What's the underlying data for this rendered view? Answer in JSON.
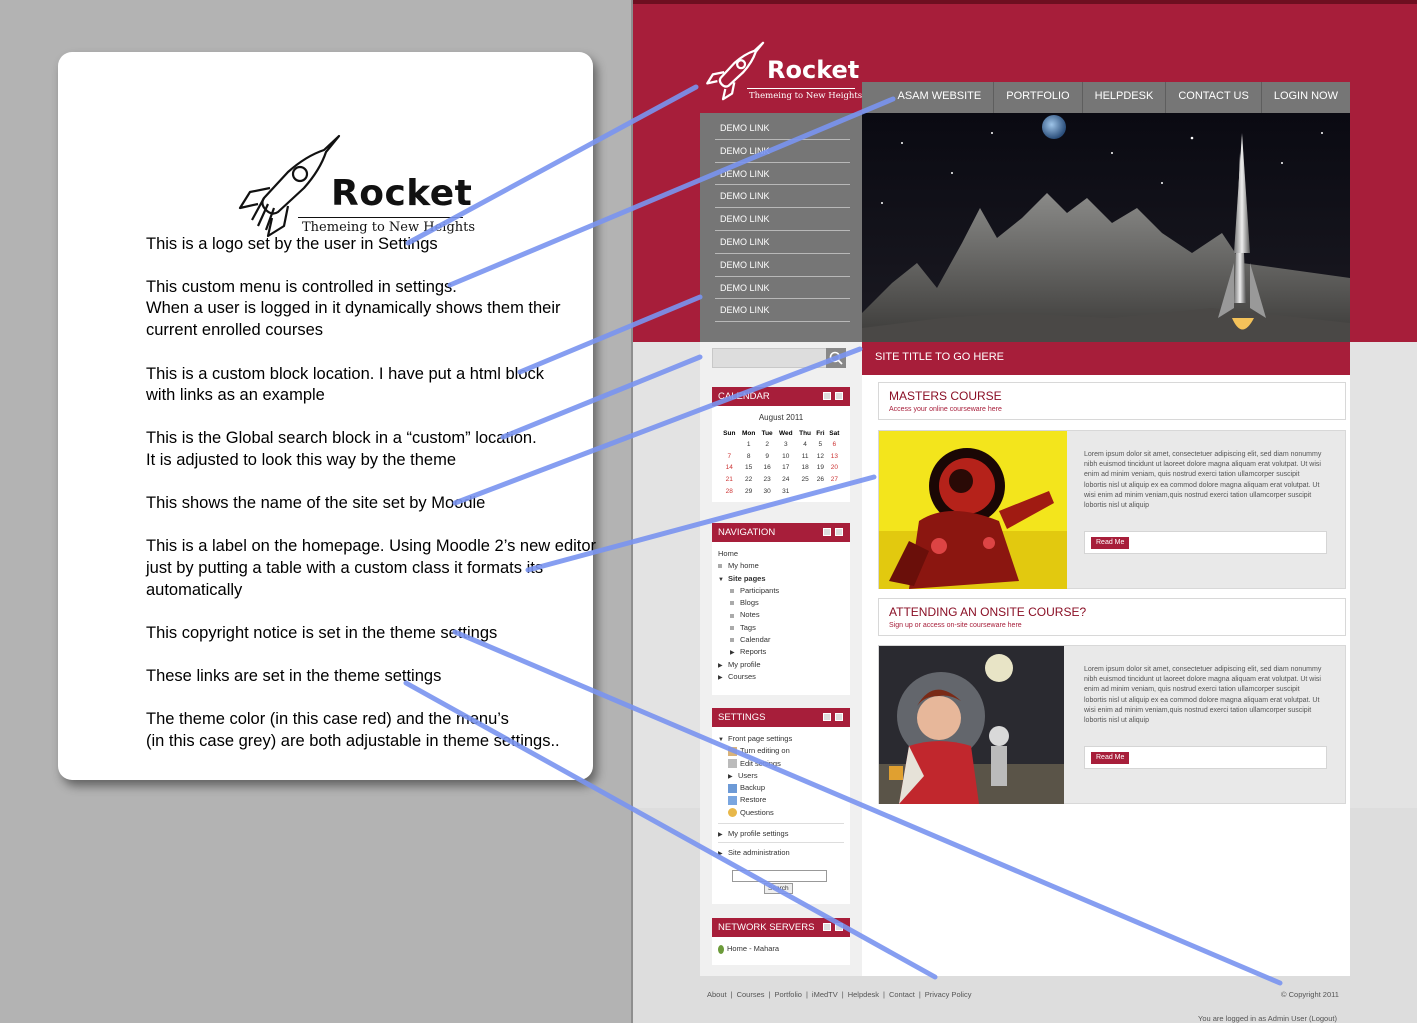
{
  "card": {
    "logo_name": "Rocket",
    "logo_tagline": "Themeing to New Heights",
    "notes": [
      "This is a logo set by the user in Settings",
      "This custom menu is controlled in settings.",
      "When a user is logged in it dynamically shows them their",
      "current enrolled courses",
      "This is a custom block location. I have put a html block",
      "with links as an example",
      "This is the Global search block in a “custom” location.",
      "It is adjusted to look this way by the theme",
      "This shows the name of the site set by Moodle",
      "This is a label on the homepage. Using Moodle 2’s new editor",
      "just by putting a table with a custom class it formats its",
      "automatically",
      "This copyright notice is set in the theme settings",
      "These links are set in the theme settings",
      "The theme color (in this case red) and the menu’s",
      "(in this case grey) are both adjustable in theme settings.."
    ]
  },
  "site": {
    "logo_name": "Rocket",
    "logo_tagline": "Themeing to New Heights",
    "menu": [
      "ASAM WEBSITE",
      "PORTFOLIO",
      "HELPDESK",
      "CONTACT US",
      "LOGIN NOW"
    ],
    "demo_links": [
      "DEMO LINK",
      "DEMO LINK",
      "DEMO LINK",
      "DEMO LINK",
      "DEMO LINK",
      "DEMO LINK",
      "DEMO LINK",
      "DEMO LINK",
      "DEMO LINK"
    ],
    "site_title": "SITE TITLE TO GO HERE",
    "calendar": {
      "heading": "CALENDAR",
      "month": "August 2011",
      "days": [
        "Sun",
        "Mon",
        "Tue",
        "Wed",
        "Thu",
        "Fri",
        "Sat"
      ],
      "weeks": [
        [
          "",
          "1",
          "2",
          "3",
          "4",
          "5",
          "6"
        ],
        [
          "7",
          "8",
          "9",
          "10",
          "11",
          "12",
          "13"
        ],
        [
          "14",
          "15",
          "16",
          "17",
          "18",
          "19",
          "20"
        ],
        [
          "21",
          "22",
          "23",
          "24",
          "25",
          "26",
          "27"
        ],
        [
          "28",
          "29",
          "30",
          "31",
          "",
          "",
          ""
        ]
      ]
    },
    "navigation": {
      "heading": "NAVIGATION",
      "home": "Home",
      "my_home": "My home",
      "site_pages": "Site pages",
      "sub": [
        "Participants",
        "Blogs",
        "Notes",
        "Tags",
        "Calendar",
        "Reports"
      ],
      "my_profile": "My profile",
      "courses": "Courses"
    },
    "settings": {
      "heading": "SETTINGS",
      "front_page": "Front page settings",
      "items": [
        "Turn editing on",
        "Edit settings",
        "Users",
        "Backup",
        "Restore",
        "Questions"
      ],
      "my_profile": "My profile settings",
      "site_admin": "Site administration",
      "search_button": "Search"
    },
    "network": {
      "heading": "NETWORK SERVERS",
      "item": "Home - Mahara"
    },
    "courses": [
      {
        "title": "MASTERS COURSE",
        "subtitle": "Access your online courseware here",
        "body": "Lorem ipsum dolor sit amet, consectetuer adipiscing elit, sed diam nonummy nibh euismod tincidunt ut laoreet dolore magna aliquam erat volutpat. Ut wisi enim ad minim veniam, quis nostrud exerci tation ullamcorper suscipit lobortis nisl ut aliquip ex ea commod dolore magna aliquam erat volutpat. Ut wisi enim ad minim veniam,quis nostrud exerci tation ullamcorper suscipit lobortis nisl ut aliquip",
        "button": "Read Me"
      },
      {
        "title": "ATTENDING AN ONSITE COURSE?",
        "subtitle": "Sign up or access on-site courseware here",
        "body": "Lorem ipsum dolor sit amet, consectetuer adipiscing elit, sed diam nonummy nibh euismod tincidunt ut laoreet dolore magna aliquam erat volutpat. Ut wisi enim ad minim veniam, quis nostrud exerci tation ullamcorper suscipit lobortis nisl ut aliquip ex ea commod dolore magna aliquam erat volutpat. Ut wisi enim ad minim veniam,quis nostrud exerci tation ullamcorper suscipit lobortis nisl ut aliquip",
        "button": "Read Me"
      }
    ],
    "footer_links": [
      "About",
      "Courses",
      "Portfolio",
      "iMedTV",
      "Helpdesk",
      "Contact",
      "Privacy Policy"
    ],
    "copyright": "© Copyright 2011",
    "logged_in": "You are logged in as Admin User (Logout)"
  },
  "colors": {
    "theme": "#a71e3a",
    "menu": "#767676",
    "pointer_lines": "#7a94f0"
  }
}
